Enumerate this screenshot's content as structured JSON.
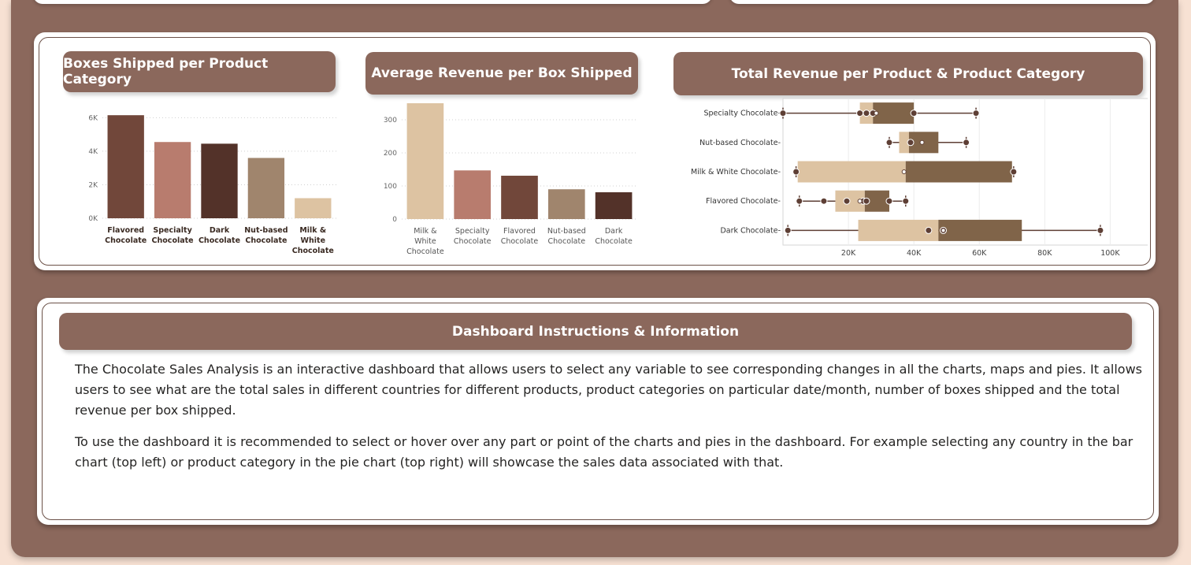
{
  "colors": {
    "frame": "#8b685c",
    "background": "#f7e1d3",
    "dark_brown": "#71473a",
    "rose": "#b87c6e",
    "espresso": "#533229",
    "tan": "#a0856d",
    "cream": "#ddc3a2",
    "box_light": "#ddc3a2",
    "box_dark": "#806449",
    "whisker": "#5e3f35"
  },
  "boxes_shipped": {
    "title": "Boxes Shipped per Product Category",
    "chart_data": {
      "type": "bar",
      "title": "Boxes Shipped per Product Category",
      "categories": [
        "Flavored Chocolate",
        "Specialty Chocolate",
        "Dark Chocolate",
        "Nut-based Chocolate",
        "Milk & White Chocolate"
      ],
      "category_lines": [
        [
          "Flavored",
          "Chocolate"
        ],
        [
          "Specialty",
          "Chocolate"
        ],
        [
          "Dark",
          "Chocolate"
        ],
        [
          "Nut-based",
          "Chocolate"
        ],
        [
          "Milk &",
          "White",
          "Chocolate"
        ]
      ],
      "values": [
        6150,
        4550,
        4450,
        3600,
        1200
      ],
      "bar_colors": [
        "#71473a",
        "#b87c6e",
        "#533229",
        "#a0856d",
        "#ddc3a2"
      ],
      "ylim": [
        0,
        6300
      ],
      "yticks": [
        0,
        2000,
        4000,
        6000
      ],
      "ytick_labels": [
        "0K",
        "2K",
        "4K",
        "6K"
      ],
      "grid": true
    }
  },
  "avg_revenue": {
    "title": "Average Revenue per Box Shipped",
    "chart_data": {
      "type": "bar",
      "title": "Average Revenue per Box Shipped",
      "categories": [
        "Milk & White Chocolate",
        "Specialty Chocolate",
        "Flavored Chocolate",
        "Nut-based Chocolate",
        "Dark Chocolate"
      ],
      "category_lines": [
        [
          "Milk &",
          "White",
          "Chocolate"
        ],
        [
          "Specialty",
          "Chocolate"
        ],
        [
          "Flavored",
          "Chocolate"
        ],
        [
          "Nut-based",
          "Chocolate"
        ],
        [
          "Dark",
          "Chocolate"
        ]
      ],
      "values": [
        350,
        147,
        131,
        90,
        81
      ],
      "bar_colors": [
        "#ddc3a2",
        "#b87c6e",
        "#71473a",
        "#a0856d",
        "#533229"
      ],
      "ylim": [
        0,
        350
      ],
      "yticks": [
        0,
        100,
        200,
        300
      ],
      "ytick_labels": [
        "0",
        "100",
        "200",
        "300"
      ],
      "grid": true
    }
  },
  "total_revenue": {
    "title": "Total Revenue per Product & Product Category",
    "chart_data": {
      "type": "box",
      "title": "Total Revenue per Product & Product Category",
      "categories": [
        "Specialty Chocolate",
        "Nut-based Chocolate",
        "Milk & White Chocolate",
        "Flavored Chocolate",
        "Dark Chocolate"
      ],
      "category_labels": [
        "Specialty Chocolate",
        "Nut-based Chocolate",
        "Milk & White Chocolate",
        "Flavored Chocolate",
        "Dark Chocolate"
      ],
      "series": [
        {
          "min": 0,
          "q1": 23500,
          "median": 27500,
          "q3": 40000,
          "max": 59000,
          "mean": 28500,
          "points": [
            0,
            23500,
            25500,
            27500,
            40000,
            59000
          ]
        },
        {
          "min": 32500,
          "q1": 35500,
          "median": 38500,
          "q3": 47500,
          "max": 56000,
          "mean": 42500,
          "points": [
            32500,
            39000,
            56000
          ]
        },
        {
          "min": 4000,
          "q1": 4500,
          "median": 37500,
          "q3": 70000,
          "max": 70500,
          "mean": 37000,
          "points": [
            4000,
            70500
          ]
        },
        {
          "min": 5000,
          "q1": 16000,
          "median": 25000,
          "q3": 32500,
          "max": 37500,
          "mean": 23500,
          "points": [
            5000,
            12500,
            19500,
            24500,
            25500,
            32500,
            37500
          ]
        },
        {
          "min": 1500,
          "q1": 23000,
          "median": 47500,
          "q3": 73000,
          "max": 97000,
          "mean": 49000,
          "points": [
            1500,
            44500,
            49000,
            97000
          ]
        }
      ],
      "xlim": [
        0,
        117000
      ],
      "xticks": [
        20000,
        40000,
        60000,
        80000,
        100000
      ],
      "xtick_labels": [
        "20K",
        "40K",
        "60K",
        "80K",
        "100K"
      ],
      "grid": true
    }
  },
  "info": {
    "title": "Dashboard Instructions & Information",
    "paragraph1": "The Chocolate Sales Analysis is an interactive dashboard that allows users to select any variable to see corresponding changes in all the charts, maps and pies. It allows users to see what are the total sales in different countries for different products, product categories on particular date/month, number of boxes shipped and the total revenue per box shipped.",
    "paragraph2": "To use the dashboard it is recommended to select or hover over any part or point of the charts and pies in the dashboard. For example selecting any country in the bar chart (top left) or product category in the pie chart (top right) will showcase the sales data associated with that."
  }
}
